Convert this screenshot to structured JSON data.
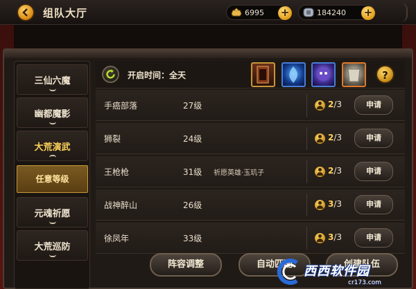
{
  "header": {
    "title": "组队大厅",
    "gold": "6995",
    "silver": "184240",
    "plus": "+"
  },
  "nav": {
    "items": [
      "三仙六魔",
      "幽都魔影",
      "大荒演武",
      "元魂祈愿",
      "大荒巡防"
    ],
    "active_index": 2,
    "sub_item": "任意等级"
  },
  "info": {
    "open_time": "开启时间：全天",
    "rewards": [
      "scroll-book-icon",
      "blue-flame-icon",
      "demon-mask-icon",
      "armor-icon"
    ],
    "help": "?"
  },
  "teams": [
    {
      "name": "手癌部落",
      "level": "27级",
      "note": "",
      "count_current": "2",
      "count_sep": "/3",
      "apply": "申请"
    },
    {
      "name": "狮裂",
      "level": "24级",
      "note": "",
      "count_current": "2",
      "count_sep": "/3",
      "apply": "申请"
    },
    {
      "name": "王枪枪",
      "level": "31级",
      "note": "祈愿英雄·玉玑子",
      "count_current": "2",
      "count_sep": "/3",
      "apply": "申请"
    },
    {
      "name": "战神醉山",
      "level": "26级",
      "note": "",
      "count_current": "3",
      "count_sep": "/3",
      "apply": "申请"
    },
    {
      "name": "徐凤年",
      "level": "33级",
      "note": "",
      "count_current": "3",
      "count_sep": "/3",
      "apply": "申请"
    }
  ],
  "bottom": {
    "lineup": "阵容调整",
    "auto": "自动匹配",
    "create": "创建队伍"
  },
  "watermark": {
    "text": "西西软件园",
    "url": "cr173.com"
  }
}
